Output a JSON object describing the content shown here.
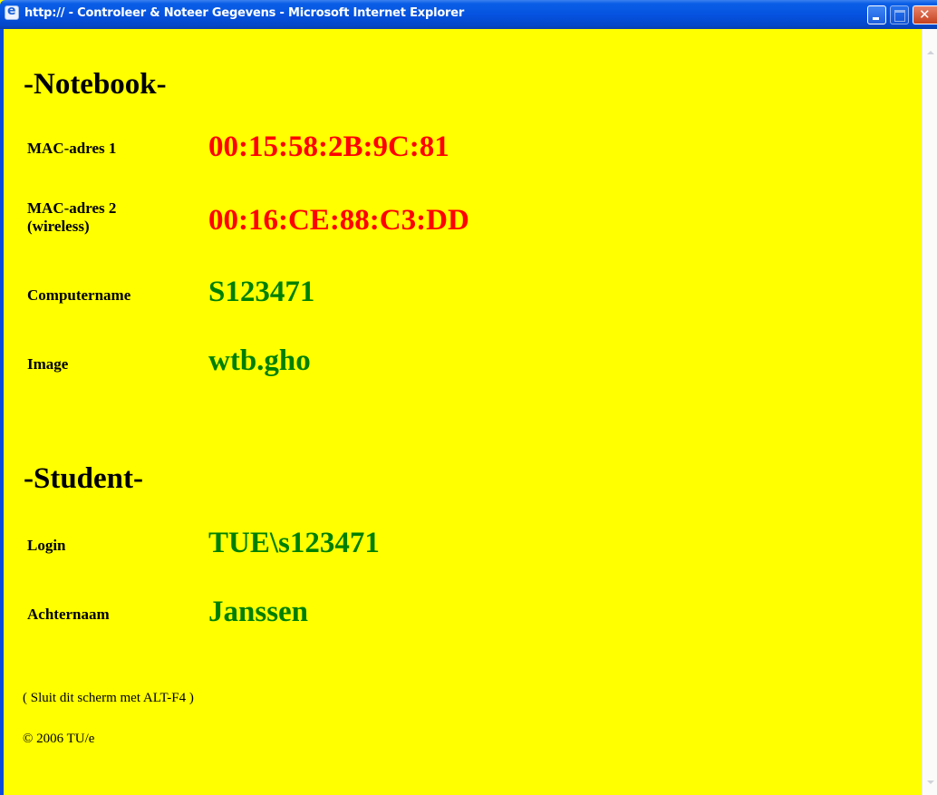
{
  "window": {
    "title": "http:// - Controleer & Noteer Gegevens - Microsoft Internet Explorer"
  },
  "notebook": {
    "heading": "-Notebook-",
    "mac1": {
      "label": "MAC-adres 1",
      "value": "00:15:58:2B:9C:81",
      "color": "#ff0000"
    },
    "mac2": {
      "label_line1": "MAC-adres 2",
      "label_line2": "(wireless)",
      "value": "00:16:CE:88:C3:DD",
      "color": "#ff0000"
    },
    "computername": {
      "label": "Computername",
      "value": "S123471",
      "color": "#008000"
    },
    "image": {
      "label": "Image",
      "value": "wtb.gho",
      "color": "#008000"
    }
  },
  "student": {
    "heading": "-Student-",
    "login": {
      "label": "Login",
      "value": "TUE\\s123471",
      "color": "#008000"
    },
    "achternaam": {
      "label": "Achternaam",
      "value": "Janssen",
      "color": "#008000"
    }
  },
  "footer": {
    "hint": "( Sluit dit scherm met ALT-F4 )",
    "copyright": "© 2006 TU/e"
  },
  "page_background": "#ffff00"
}
